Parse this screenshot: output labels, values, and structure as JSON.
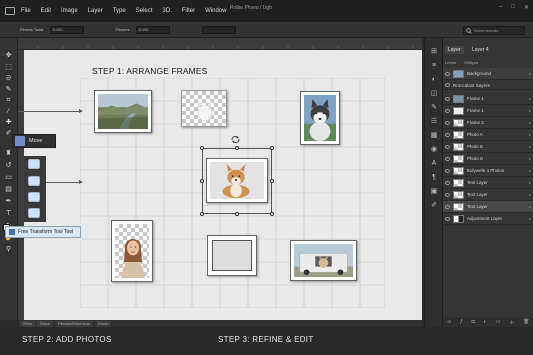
{
  "window": {
    "title": "Roibe Phseo / Ugb",
    "controls": [
      "–",
      "□",
      "✕"
    ]
  },
  "menu": [
    "File",
    "Edit",
    "Image",
    "Layer",
    "Type",
    "Select",
    "3D:",
    "Filter",
    "Window"
  ],
  "options_bar": {
    "fields": [
      {
        "label": "Fitness Todst",
        "value": "3:100"
      },
      {
        "label": "Fisnnes",
        "value": "5:100"
      },
      {
        "label": "",
        "value": ""
      }
    ],
    "search_placeholder": "Savernosinds"
  },
  "tooltips": {
    "move": "Move",
    "free_transform": "Free Transform Tool Tool"
  },
  "canvas": {
    "heading": "STEP 1: ARRANGE FRAMES"
  },
  "captions": {
    "step2": "STEP 2:    ADD PHOTOS",
    "step3": "STEP 3: REFINE & EDIT"
  },
  "status_bar": [
    "Sires",
    "Dsive",
    "Fileaus/Dimensus",
    "Chuin"
  ],
  "layers_panel": {
    "tabs": [
      "Layer",
      "Layer 4"
    ],
    "header_items": [
      "Lrtnes",
      "Wittlyes"
    ],
    "background_label": "Background",
    "group_label": "Rroccalant Sayers",
    "layers": [
      "Frame 1",
      "Frame 1",
      "Frame 2",
      "Photo A",
      "Photo B",
      "Photo B",
      "Eulywefe 4 Photos",
      "Text Layer",
      "Text Layer",
      "Text Layer",
      "Adjustment Layer"
    ]
  },
  "colors": {
    "app_bg": "#2b2b2b",
    "canvas_bg": "#e9e9e9",
    "accent": "#6f8fc7"
  }
}
